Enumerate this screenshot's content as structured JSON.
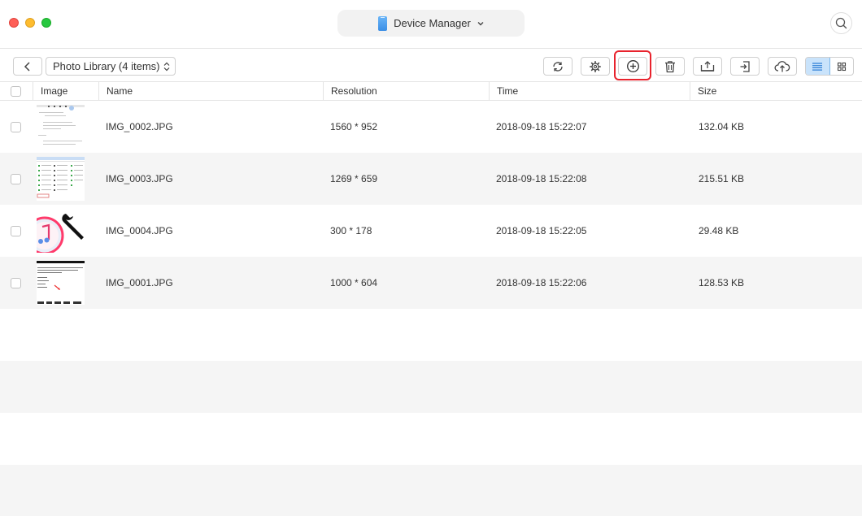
{
  "window": {
    "device_label": "Device Manager"
  },
  "toolbar": {
    "library_label": "Photo Library (4 items)",
    "buttons": [
      "back-icon",
      "refresh-icon",
      "settings-icon",
      "add-icon",
      "delete-icon",
      "export-to-computer-icon",
      "send-to-device-icon",
      "upload-to-cloud-icon"
    ],
    "view_modes": [
      "list-view-icon",
      "grid-view-icon"
    ],
    "active_view": "list",
    "highlighted_button": "add",
    "highlight_color": "#e8232d"
  },
  "table": {
    "headers": {
      "image": "Image",
      "name": "Name",
      "resolution": "Resolution",
      "time": "Time",
      "size": "Size"
    },
    "rows": [
      {
        "name": "IMG_0002.JPG",
        "resolution": "1560 * 952",
        "time": "2018-09-18 15:22:07",
        "size": "132.04 KB"
      },
      {
        "name": "IMG_0003.JPG",
        "resolution": "1269 * 659",
        "time": "2018-09-18 15:22:08",
        "size": "215.51 KB"
      },
      {
        "name": "IMG_0004.JPG",
        "resolution": "300 * 178",
        "time": "2018-09-18 15:22:05",
        "size": "29.48 KB"
      },
      {
        "name": "IMG_0001.JPG",
        "resolution": "1000 * 604",
        "time": "2018-09-18 15:22:06",
        "size": "128.53 KB"
      }
    ]
  },
  "colors": {
    "accent_blue": "#c9e3fb",
    "row_alt": "#f5f5f5",
    "close": "#fe5f57",
    "minimize": "#febc2e",
    "zoom": "#28c840"
  }
}
